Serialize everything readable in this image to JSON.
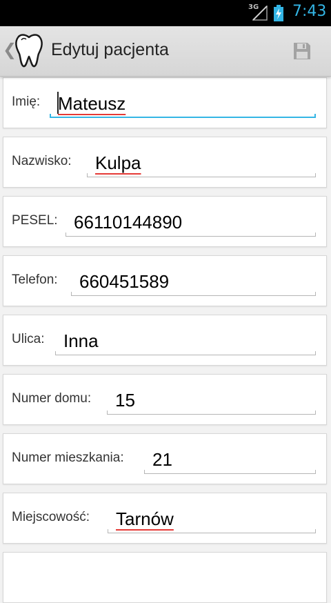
{
  "status_bar": {
    "network": "3G",
    "time": "7:43",
    "accent_color": "#33b5e5",
    "icons": [
      "signal-icon",
      "battery-charging-icon"
    ]
  },
  "action_bar": {
    "up_caret": "❮",
    "title": "Edytuj pacjenta",
    "app_icon": "tooth-icon",
    "save_icon": "floppy-disk-save-icon"
  },
  "form": {
    "fields": [
      {
        "label": "Imię:",
        "value": "Mateusz",
        "focused": true,
        "spellcheck_flag": true
      },
      {
        "label": "Nazwisko:",
        "value": "Kulpa",
        "focused": false,
        "spellcheck_flag": true
      },
      {
        "label": "PESEL:",
        "value": "66110144890",
        "focused": false,
        "spellcheck_flag": false
      },
      {
        "label": "Telefon:",
        "value": "660451589",
        "focused": false,
        "spellcheck_flag": false
      },
      {
        "label": "Ulica:",
        "value": "Inna",
        "focused": false,
        "spellcheck_flag": false
      },
      {
        "label": "Numer domu:",
        "value": "15",
        "focused": false,
        "spellcheck_flag": false
      },
      {
        "label": "Numer mieszkania:",
        "value": "21",
        "focused": false,
        "spellcheck_flag": false
      },
      {
        "label": "Miejscowość:",
        "value": "Tarnów",
        "focused": false,
        "spellcheck_flag": true
      }
    ]
  }
}
